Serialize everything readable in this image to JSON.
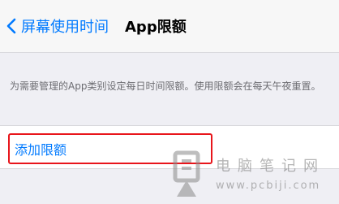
{
  "nav": {
    "back_label": "屏幕使用时间",
    "title": "App限额"
  },
  "footnote": "为需要管理的App类别设定每日时间限额。使用限额会在每天午夜重置。",
  "add_limit": {
    "label": "添加限额"
  },
  "watermark": {
    "title": "电脑笔记网",
    "url": "www.pcbiji.com"
  },
  "colors": {
    "accent": "#007aff",
    "highlight": "#e8151b",
    "background": "#efeff4"
  }
}
